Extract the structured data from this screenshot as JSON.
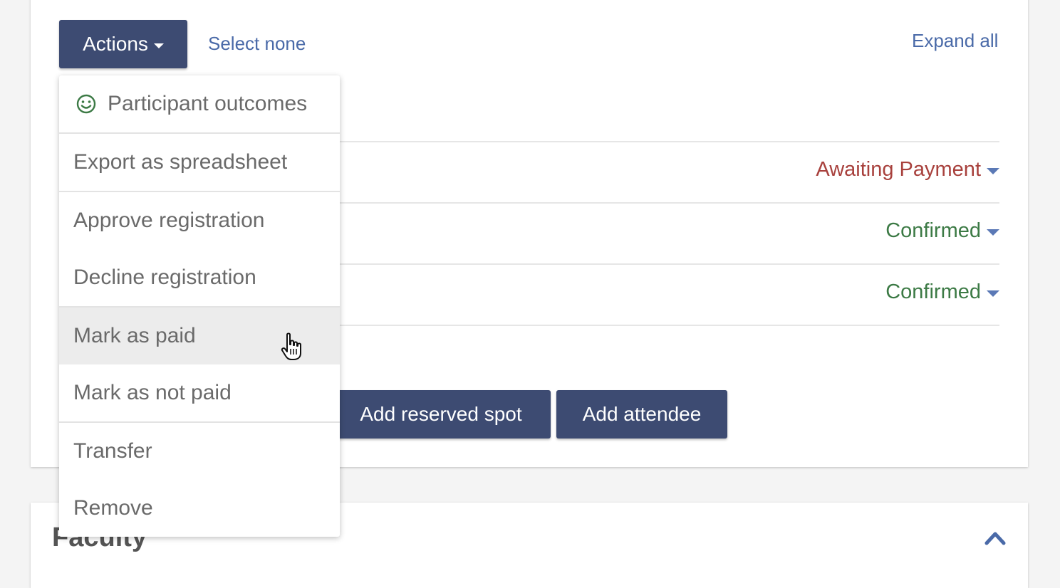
{
  "toolbar": {
    "actions_label": "Actions",
    "select_none_label": "Select none",
    "expand_all_label": "Expand all"
  },
  "rows": [
    {
      "status": "Awaiting Payment",
      "status_color": "#a8413d"
    },
    {
      "status": "Confirmed",
      "status_color": "#3c7a45"
    },
    {
      "status": "Confirmed",
      "status_color": "#3c7a45"
    }
  ],
  "buttons": {
    "add_reserved_spot": "Add reserved spot",
    "add_attendee": "Add attendee"
  },
  "faculty": {
    "title": "Faculty"
  },
  "actions_menu": {
    "items": [
      {
        "label": "Participant outcomes",
        "icon": "smile-icon"
      },
      {
        "label": "Export as spreadsheet"
      },
      {
        "label": "Approve registration"
      },
      {
        "label": "Decline registration"
      },
      {
        "label": "Mark as paid",
        "hovered": true
      },
      {
        "label": "Mark as not paid"
      },
      {
        "label": "Transfer"
      },
      {
        "label": "Remove"
      }
    ]
  },
  "colors": {
    "primary_button": "#3d4b72",
    "link": "#4a6aa8",
    "icon_green": "#3c7a45",
    "awaiting": "#a8413d",
    "confirmed": "#3c7a45"
  }
}
